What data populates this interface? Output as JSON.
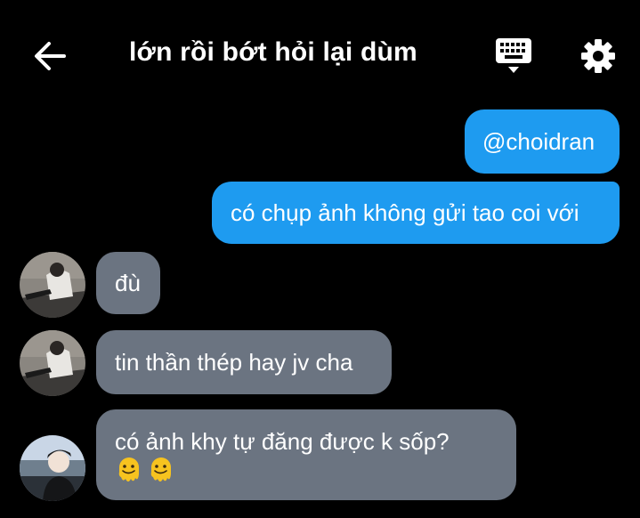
{
  "header": {
    "title": "lớn rồi bớt hỏi lại dùm"
  },
  "messages": [
    {
      "direction": "out",
      "text": "@choidran"
    },
    {
      "direction": "out",
      "text": "có chụp ảnh không gửi tao coi với"
    },
    {
      "direction": "in",
      "text": "đù"
    },
    {
      "direction": "in",
      "text": "tin thần thép hay jv cha"
    },
    {
      "direction": "in",
      "text": "có ảnh khy tự đăng được k sốp?",
      "emojis": [
        "melting-face",
        "melting-face"
      ]
    }
  ],
  "colors": {
    "background": "#000000",
    "outgoing_bubble": "#1e9bf0",
    "incoming_bubble": "#6b7481"
  }
}
